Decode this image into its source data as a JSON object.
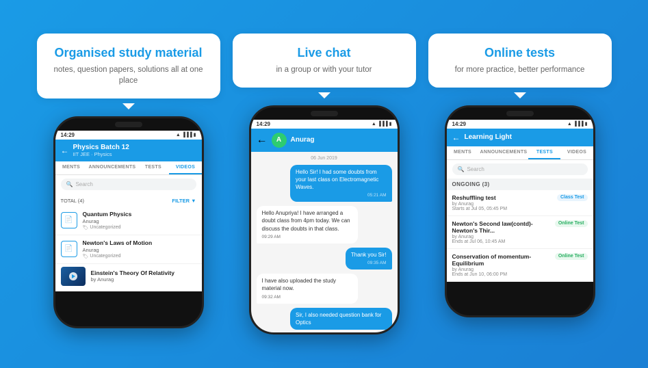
{
  "panels": [
    {
      "id": "study-material",
      "callout": {
        "heading": "Organised study material",
        "subtext": "notes, question papers, solutions all at one place"
      },
      "phone": {
        "time": "14:29",
        "app_title": "Physics Batch 12",
        "app_subtitle": "IIT JEE · Physics",
        "tabs": [
          "MENTS",
          "ANNOUNCEMENTS",
          "TESTS",
          "VIDEOS"
        ],
        "active_tab": "VIDEOS",
        "search_placeholder": "Search",
        "filter_label": "TOTAL (4)",
        "filter_btn": "FILTER",
        "files": [
          {
            "name": "Quantum Physics",
            "author": "Anurag",
            "tag": "Uncategorized"
          },
          {
            "name": "Newton's Laws of Motion",
            "author": "Anurag",
            "tag": "Uncategorized"
          }
        ],
        "video": {
          "name": "Einstein's Theory Of Relativity",
          "author": "by Anurag"
        }
      }
    },
    {
      "id": "live-chat",
      "callout": {
        "heading": "Live chat",
        "subtext": "in a group or with your tutor"
      },
      "phone": {
        "time": "14:29",
        "chat_name": "Anurag",
        "chat_avatar_letter": "A",
        "date_divider": "06 Jun 2019",
        "messages": [
          {
            "type": "sent",
            "text": "Hello Sir! I had some doubts from your last class on Electromagnetic Waves.",
            "time": "05:21 AM",
            "align": "right"
          },
          {
            "type": "received",
            "text": "Hello Anupriya! I have arranged a doubt class from 4pm today. We can discuss the doubts in that class.",
            "time": "09:29 AM",
            "align": "left"
          },
          {
            "type": "sent",
            "text": "Thank you Sir!",
            "time": "09:35 AM",
            "align": "right"
          },
          {
            "type": "received",
            "text": "I have also uploaded the study material now.",
            "time": "09:32 AM",
            "align": "left"
          },
          {
            "type": "sent",
            "text": "Sir, I also needed question bank for Optics",
            "time": "",
            "align": "right"
          }
        ]
      }
    },
    {
      "id": "online-tests",
      "callout": {
        "heading": "Online tests",
        "subtext": "for more practice, better performance"
      },
      "phone": {
        "time": "14:29",
        "app_title": "Learning Light",
        "tabs": [
          "MENTS",
          "ANNOUNCEMENTS",
          "TESTS",
          "VIDEOS"
        ],
        "active_tab": "TESTS",
        "search_placeholder": "Search",
        "ongoing_label": "ONGOING (3)",
        "tests": [
          {
            "name": "Reshuffling test",
            "author": "by Anurag",
            "date": "Starts at Jul 05, 05:45 PM",
            "badge": "Class Test",
            "badge_type": "class"
          },
          {
            "name": "Newton's Second law(contd)-Newton's Thir...",
            "author": "by Anurag",
            "date": "Ends at Jul 06, 10:45 AM",
            "badge": "Online Test",
            "badge_type": "online"
          },
          {
            "name": "Conservation of momentum-Equilibrium",
            "author": "by Anurag",
            "date": "Ends at Jun 10, 06:00 PM",
            "badge": "Online Test",
            "badge_type": "online"
          }
        ]
      }
    }
  ]
}
